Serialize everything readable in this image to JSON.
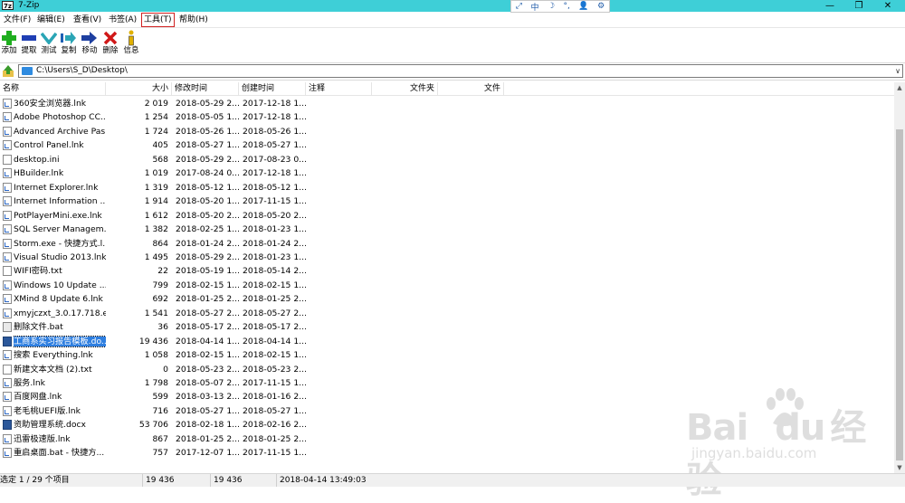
{
  "window": {
    "app_icon_text": "7z",
    "title": "7-Zip",
    "minimize": "—",
    "maximize": "❐",
    "close": "✕"
  },
  "ime": {
    "items": [
      "⤢",
      "中",
      "☽",
      "°,",
      "👤",
      "⚙"
    ]
  },
  "menu": [
    {
      "label": "文件(F)"
    },
    {
      "label": "编辑(E)"
    },
    {
      "label": "查看(V)"
    },
    {
      "label": "书签(A)"
    },
    {
      "label": "工具(T)",
      "highlighted": true
    },
    {
      "label": "帮助(H)"
    }
  ],
  "toolbar": [
    {
      "label": "添加",
      "icon": "plus-icon"
    },
    {
      "label": "提取",
      "icon": "minus-icon"
    },
    {
      "label": "测试",
      "icon": "check-icon"
    },
    {
      "label": "复制",
      "icon": "copy-arrow-icon"
    },
    {
      "label": "移动",
      "icon": "move-arrow-icon"
    },
    {
      "label": "删除",
      "icon": "delete-x-icon"
    },
    {
      "label": "信息",
      "icon": "info-icon"
    }
  ],
  "address": {
    "path": "C:\\Users\\S_D\\Desktop\\",
    "dropdown": "∨"
  },
  "columns": [
    "名称",
    "大小",
    "修改时间",
    "创建时间",
    "注释",
    "文件夹",
    "文件"
  ],
  "files": [
    {
      "name": "360安全浏览器.lnk",
      "size": "2 019",
      "modified": "2018-05-29 2...",
      "created": "2017-12-18 1...",
      "type": "lnk"
    },
    {
      "name": "Adobe Photoshop CC...",
      "size": "1 254",
      "modified": "2018-05-05 1...",
      "created": "2017-12-18 1...",
      "type": "lnk"
    },
    {
      "name": "Advanced Archive Pas...",
      "size": "1 724",
      "modified": "2018-05-26 1...",
      "created": "2018-05-26 1...",
      "type": "lnk"
    },
    {
      "name": "Control Panel.lnk",
      "size": "405",
      "modified": "2018-05-27 1...",
      "created": "2018-05-27 1...",
      "type": "lnk"
    },
    {
      "name": "desktop.ini",
      "size": "568",
      "modified": "2018-05-29 2...",
      "created": "2017-08-23 0...",
      "type": "ini"
    },
    {
      "name": "HBuilder.lnk",
      "size": "1 019",
      "modified": "2017-08-24 0...",
      "created": "2017-12-18 1...",
      "type": "lnk"
    },
    {
      "name": "Internet Explorer.lnk",
      "size": "1 319",
      "modified": "2018-05-12 1...",
      "created": "2018-05-12 1...",
      "type": "lnk"
    },
    {
      "name": "Internet Information ...",
      "size": "1 914",
      "modified": "2018-05-20 1...",
      "created": "2017-11-15 1...",
      "type": "lnk"
    },
    {
      "name": "PotPlayerMini.exe.lnk",
      "size": "1 612",
      "modified": "2018-05-20 2...",
      "created": "2018-05-20 2...",
      "type": "lnk"
    },
    {
      "name": "SQL Server Managem...",
      "size": "1 382",
      "modified": "2018-02-25 1...",
      "created": "2018-01-23 1...",
      "type": "lnk"
    },
    {
      "name": "Storm.exe - 快捷方式.l...",
      "size": "864",
      "modified": "2018-01-24 2...",
      "created": "2018-01-24 2...",
      "type": "lnk"
    },
    {
      "name": "Visual Studio 2013.lnk",
      "size": "1 495",
      "modified": "2018-05-29 2...",
      "created": "2018-01-23 1...",
      "type": "lnk"
    },
    {
      "name": "WIFI密码.txt",
      "size": "22",
      "modified": "2018-05-19 1...",
      "created": "2018-05-14 2...",
      "type": "txt"
    },
    {
      "name": "Windows 10 Update ...",
      "size": "799",
      "modified": "2018-02-15 1...",
      "created": "2018-02-15 1...",
      "type": "lnk"
    },
    {
      "name": "XMind 8 Update 6.lnk",
      "size": "692",
      "modified": "2018-01-25 2...",
      "created": "2018-01-25 2...",
      "type": "lnk"
    },
    {
      "name": "xmyjczxt_3.0.17.718.ex...",
      "size": "1 541",
      "modified": "2018-05-27 2...",
      "created": "2018-05-27 2...",
      "type": "lnk"
    },
    {
      "name": "删除文件.bat",
      "size": "36",
      "modified": "2018-05-17 2...",
      "created": "2018-05-17 2...",
      "type": "bat"
    },
    {
      "name": "工商系实习报告模板.do...",
      "size": "19 436",
      "modified": "2018-04-14 1...",
      "created": "2018-04-14 1...",
      "type": "doc",
      "selected": true
    },
    {
      "name": "搜索 Everything.lnk",
      "size": "1 058",
      "modified": "2018-02-15 1...",
      "created": "2018-02-15 1...",
      "type": "lnk"
    },
    {
      "name": "新建文本文档 (2).txt",
      "size": "0",
      "modified": "2018-05-23 2...",
      "created": "2018-05-23 2...",
      "type": "txt"
    },
    {
      "name": "服务.lnk",
      "size": "1 798",
      "modified": "2018-05-07 2...",
      "created": "2017-11-15 1...",
      "type": "lnk"
    },
    {
      "name": "百度网盘.lnk",
      "size": "599",
      "modified": "2018-03-13 2...",
      "created": "2018-01-16 2...",
      "type": "lnk"
    },
    {
      "name": "老毛桃UEFI版.lnk",
      "size": "716",
      "modified": "2018-05-27 1...",
      "created": "2018-05-27 1...",
      "type": "lnk"
    },
    {
      "name": "资助管理系统.docx",
      "size": "53 706",
      "modified": "2018-02-18 1...",
      "created": "2018-02-16 2...",
      "type": "doc"
    },
    {
      "name": "迅雷极速版.lnk",
      "size": "867",
      "modified": "2018-01-25 2...",
      "created": "2018-01-25 2...",
      "type": "lnk"
    },
    {
      "name": "重启桌面.bat - 快捷方...",
      "size": "757",
      "modified": "2017-12-07 1...",
      "created": "2017-11-15 1...",
      "type": "lnk"
    }
  ],
  "status": {
    "selection": "选定 1 / 29 个项目",
    "size": "19 436",
    "packed": "19 436",
    "date": "2018-04-14 13:49:03"
  },
  "watermark": {
    "brand": "Bai",
    "brand2": "du",
    "cn": "经验",
    "url": "jingyan.baidu.com"
  }
}
